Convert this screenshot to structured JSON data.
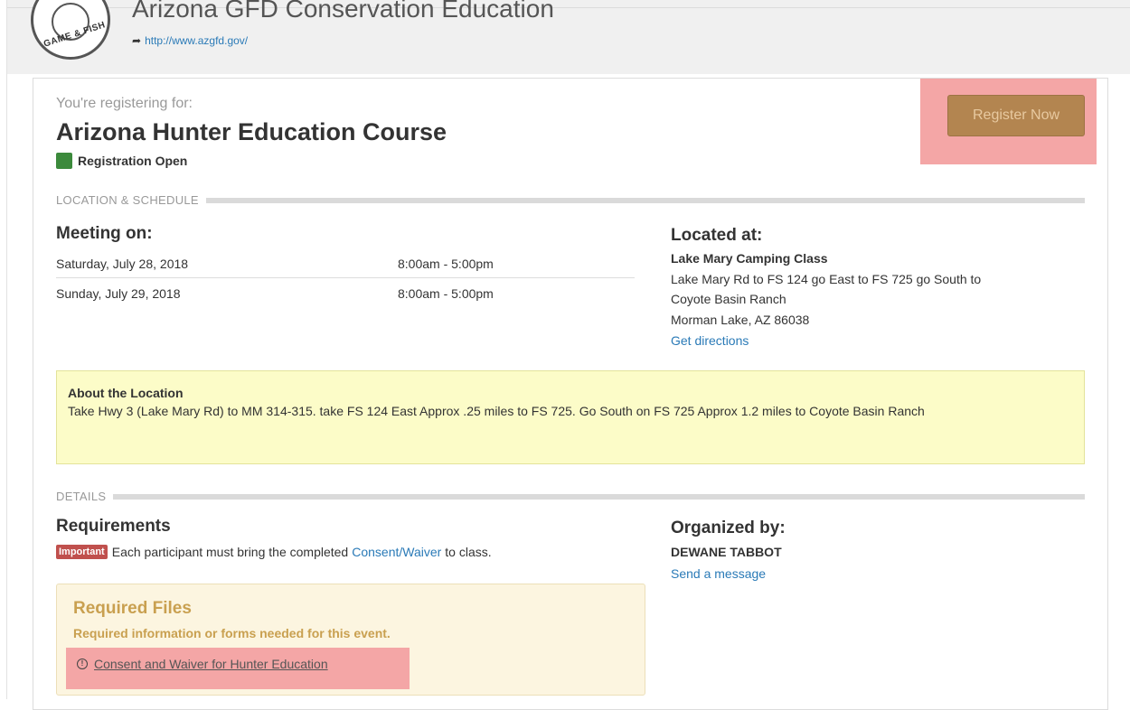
{
  "header": {
    "org_title": "Arizona GFD Conservation Education",
    "org_url": "http://www.azgfd.gov/",
    "logo_text": "GAME & FISH"
  },
  "event": {
    "registering_label": "You're registering for:",
    "title": "Arizona Hunter Education Course",
    "status": "Registration Open",
    "register_button": "Register Now"
  },
  "sections": {
    "location_schedule": "LOCATION & SCHEDULE",
    "details": "DETAILS"
  },
  "schedule": {
    "heading": "Meeting on:",
    "rows": [
      {
        "date": "Saturday, July 28, 2018",
        "time": "8:00am - 5:00pm"
      },
      {
        "date": "Sunday, July 29, 2018",
        "time": "8:00am - 5:00pm"
      }
    ]
  },
  "location": {
    "heading": "Located at:",
    "name": "Lake Mary Camping Class",
    "lines": [
      "Lake Mary Rd to FS 124 go East to FS 725 go South to",
      "Coyote Basin Ranch",
      "Morman Lake, AZ 86038"
    ],
    "directions_link": "Get directions"
  },
  "about": {
    "title": "About the Location",
    "text": "Take Hwy 3 (Lake Mary Rd) to MM 314-315. take FS 124 East Approx .25 miles to FS 725. Go South on FS 725 Approx 1.2 miles to Coyote Basin Ranch"
  },
  "requirements": {
    "heading": "Requirements",
    "badge": "Important",
    "text_before": "Each participant must bring the completed",
    "link": "Consent/Waiver",
    "text_after": "to class."
  },
  "organizer": {
    "heading": "Organized by:",
    "name": "DEWANE TABBOT",
    "message_link": "Send a message"
  },
  "files": {
    "title": "Required Files",
    "subtitle": "Required information or forms needed for this event.",
    "file_link": "Consent and Waiver for Hunter Education"
  },
  "colors": {
    "link": "#2a7ab7",
    "status_green": "#3c8a3c",
    "register_button": "#b38550",
    "highlight": "#f4a6a6",
    "about_bg": "#fcfcc8",
    "files_bg": "#fcf5e0",
    "important_badge": "#c0504d"
  },
  "icons": {
    "url_arrow": "arrow-right-icon",
    "file_alert": "exclamation-circle-icon"
  }
}
